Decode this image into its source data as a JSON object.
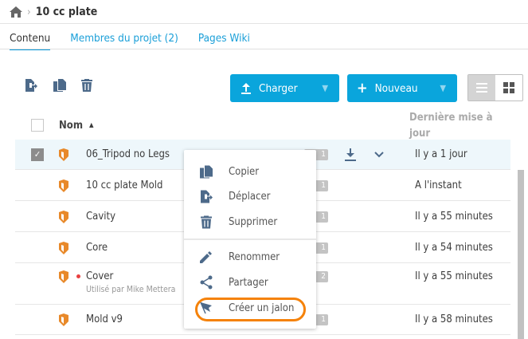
{
  "breadcrumb": {
    "title": "10 cc plate"
  },
  "tabs": [
    {
      "label": "Contenu"
    },
    {
      "label": "Membres du projet (2)"
    },
    {
      "label": "Pages Wiki"
    }
  ],
  "toolbar": {
    "upload_label": "Charger",
    "new_label": "Nouveau"
  },
  "table": {
    "col_name": "Nom",
    "col_date": "Dernière mise à jour",
    "rows": [
      {
        "name": "06_Tripod no Legs",
        "version": "1",
        "date": "Il y a 1 jour",
        "selected": true
      },
      {
        "name": "10 cc plate Mold",
        "version": "1",
        "date": "A l'instant"
      },
      {
        "name": "Cavity",
        "version": "1",
        "date": "Il y a 55 minutes"
      },
      {
        "name": "Core",
        "version": "1",
        "date": "Il y a 54 minutes"
      },
      {
        "name": "Cover",
        "version": "2",
        "date": "Il y a 55 minutes",
        "sub": "Utilisé par Mike Mettera"
      },
      {
        "name": "Mold v9",
        "version": "1",
        "date": "Il y a 58 minutes"
      }
    ]
  },
  "menu": {
    "items": [
      {
        "label": "Copier"
      },
      {
        "label": "Déplacer"
      },
      {
        "label": "Supprimer"
      },
      {
        "label": "Renommer"
      },
      {
        "label": "Partager"
      },
      {
        "label": "Créer un jalon"
      }
    ]
  },
  "colors": {
    "accent": "#0aa5dc",
    "icon": "#4d6a8a",
    "highlight": "#f5820a"
  }
}
